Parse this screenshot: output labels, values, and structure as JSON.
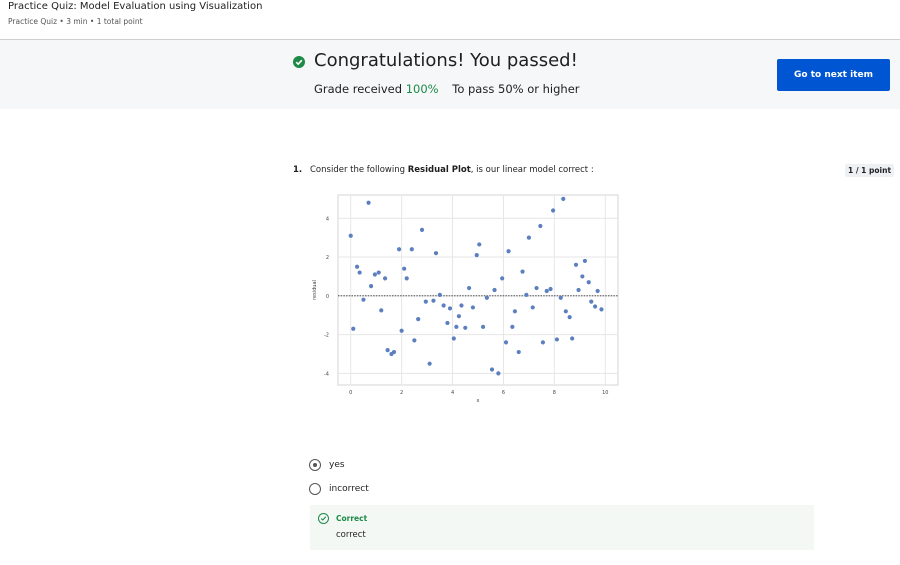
{
  "header": {
    "title": "Practice Quiz: Model Evaluation using Visualization",
    "meta": "Practice Quiz • 3 min • 1 total point"
  },
  "banner": {
    "message": "Congratulations! You passed!",
    "grade_label": "Grade received",
    "grade_value": "100%",
    "pass_label": "To pass 50% or higher",
    "next_button": "Go to next item",
    "accent_color": "#1e8a47",
    "button_color": "#0056d2"
  },
  "question": {
    "number": "1.",
    "text_before": "Consider the following ",
    "text_bold": "Residual Plot",
    "text_after": ", is our linear model correct :",
    "points": "1 / 1 point",
    "options": [
      {
        "label": "yes",
        "selected": true
      },
      {
        "label": "incorrect",
        "selected": false
      }
    ],
    "feedback": {
      "title": "Correct",
      "text": "correct"
    }
  },
  "chart_data": {
    "type": "scatter",
    "xlabel": "x",
    "ylabel": "residual",
    "xlim": [
      -0.5,
      10.5
    ],
    "ylim": [
      -4.6,
      5.2
    ],
    "xticks": [
      0,
      2,
      4,
      6,
      8,
      10
    ],
    "yticks": [
      -4,
      -2,
      0,
      2,
      4
    ],
    "grid": true,
    "reference_line": 0,
    "point_color": "#5b7fbf",
    "points": [
      [
        0.0,
        3.1
      ],
      [
        0.1,
        -1.7
      ],
      [
        0.25,
        1.5
      ],
      [
        0.35,
        1.2
      ],
      [
        0.5,
        -0.2
      ],
      [
        0.7,
        4.8
      ],
      [
        0.8,
        0.5
      ],
      [
        0.95,
        1.1
      ],
      [
        1.1,
        1.2
      ],
      [
        1.2,
        -0.75
      ],
      [
        1.35,
        0.9
      ],
      [
        1.45,
        -2.8
      ],
      [
        1.6,
        -3.0
      ],
      [
        1.7,
        -2.9
      ],
      [
        1.9,
        2.4
      ],
      [
        2.0,
        -1.8
      ],
      [
        2.1,
        1.4
      ],
      [
        2.2,
        0.9
      ],
      [
        2.4,
        2.4
      ],
      [
        2.5,
        -2.3
      ],
      [
        2.65,
        -1.2
      ],
      [
        2.8,
        3.4
      ],
      [
        2.95,
        -0.3
      ],
      [
        3.1,
        -3.5
      ],
      [
        3.25,
        -0.25
      ],
      [
        3.35,
        2.2
      ],
      [
        3.5,
        0.05
      ],
      [
        3.65,
        -0.5
      ],
      [
        3.8,
        -1.4
      ],
      [
        3.9,
        -0.65
      ],
      [
        4.05,
        -2.2
      ],
      [
        4.15,
        -1.6
      ],
      [
        4.25,
        -1.05
      ],
      [
        4.35,
        -0.5
      ],
      [
        4.5,
        -1.65
      ],
      [
        4.65,
        0.4
      ],
      [
        4.8,
        -0.6
      ],
      [
        4.95,
        2.1
      ],
      [
        5.05,
        2.65
      ],
      [
        5.2,
        -1.6
      ],
      [
        5.35,
        -0.1
      ],
      [
        5.55,
        -3.8
      ],
      [
        5.65,
        0.3
      ],
      [
        5.8,
        -4.0
      ],
      [
        5.95,
        0.9
      ],
      [
        6.1,
        -2.4
      ],
      [
        6.2,
        2.3
      ],
      [
        6.35,
        -1.6
      ],
      [
        6.45,
        -0.8
      ],
      [
        6.6,
        -2.9
      ],
      [
        6.75,
        1.25
      ],
      [
        6.9,
        0.05
      ],
      [
        7.0,
        3.0
      ],
      [
        7.15,
        -0.6
      ],
      [
        7.3,
        0.4
      ],
      [
        7.45,
        3.6
      ],
      [
        7.55,
        -2.4
      ],
      [
        7.7,
        0.25
      ],
      [
        7.85,
        0.35
      ],
      [
        7.95,
        4.4
      ],
      [
        8.1,
        -2.25
      ],
      [
        8.25,
        -0.1
      ],
      [
        8.35,
        5.0
      ],
      [
        8.45,
        -0.8
      ],
      [
        8.6,
        -1.1
      ],
      [
        8.7,
        -2.2
      ],
      [
        8.85,
        1.6
      ],
      [
        8.95,
        0.3
      ],
      [
        9.1,
        1.0
      ],
      [
        9.2,
        1.8
      ],
      [
        9.35,
        0.7
      ],
      [
        9.45,
        -0.3
      ],
      [
        9.6,
        -0.55
      ],
      [
        9.7,
        0.25
      ],
      [
        9.85,
        -0.7
      ]
    ]
  }
}
